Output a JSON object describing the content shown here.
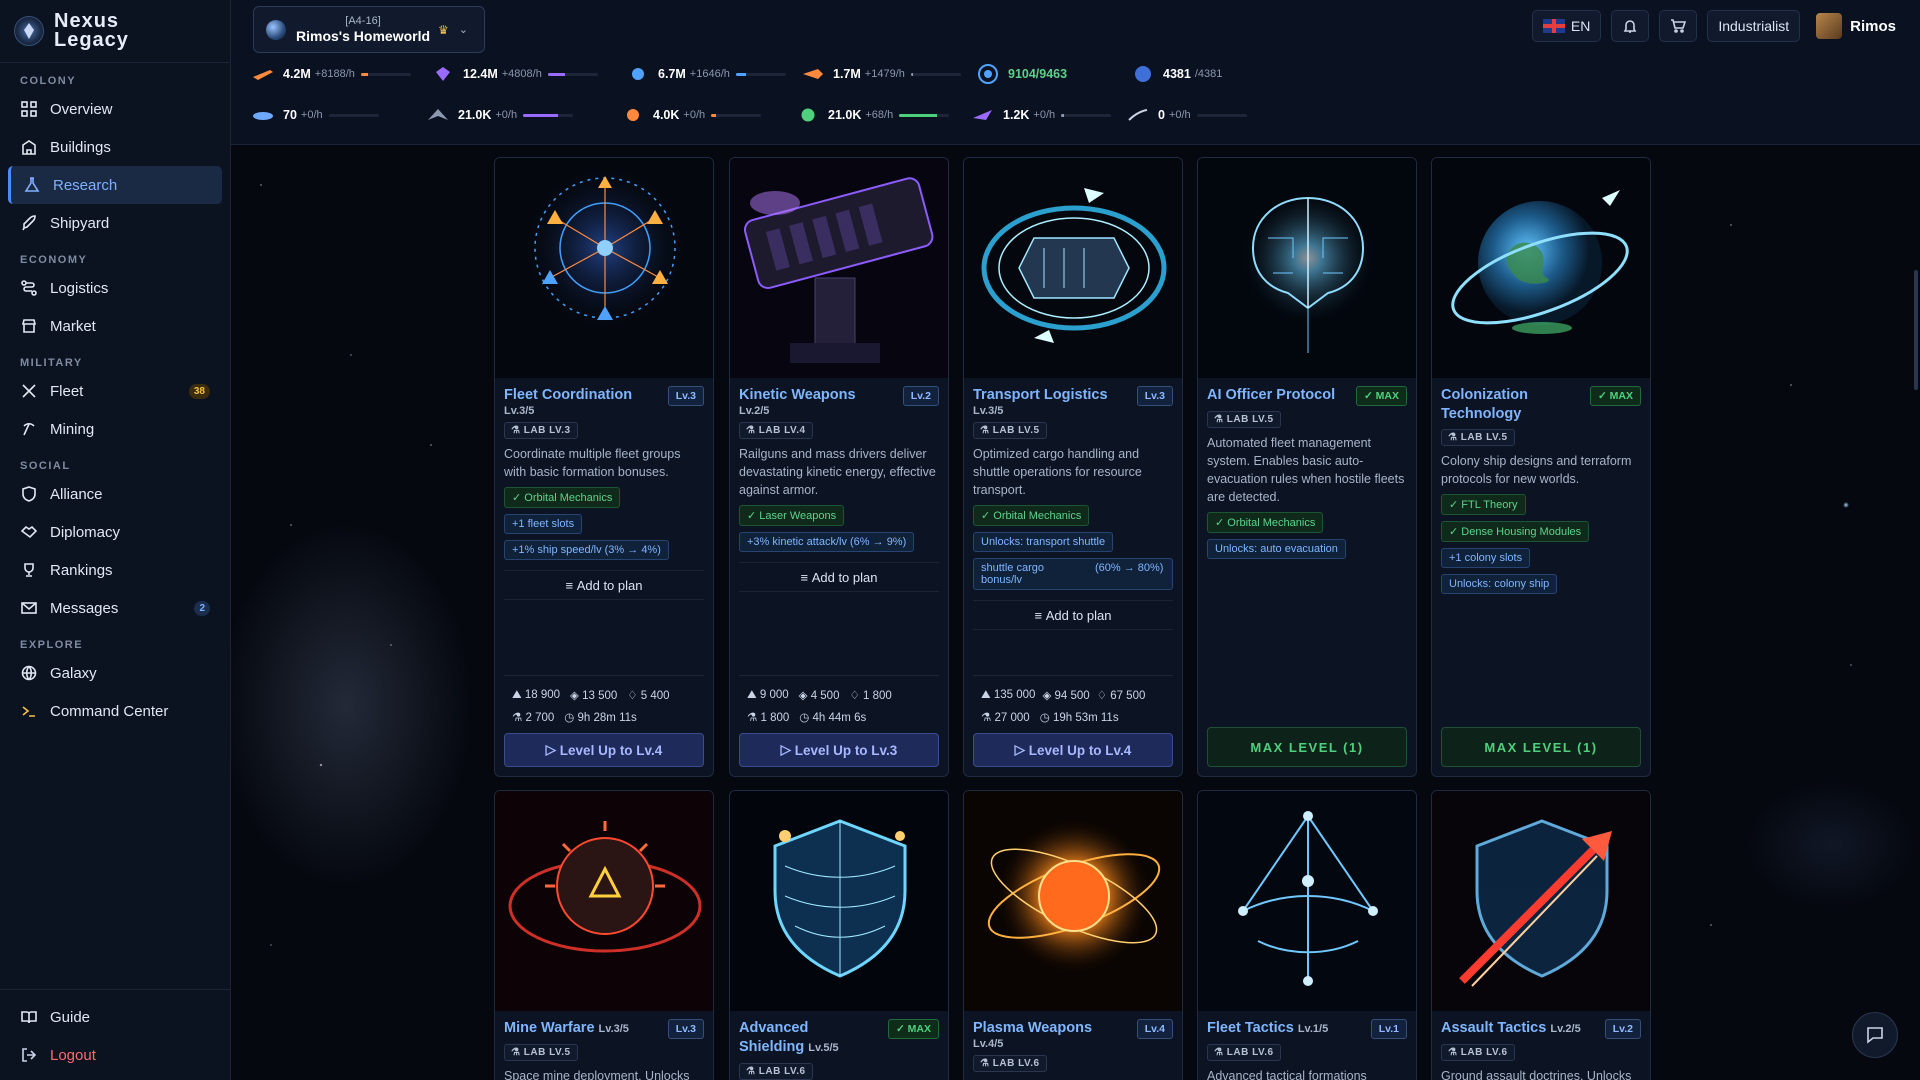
{
  "app": {
    "title_line1": "Nexus",
    "title_line2": "Legacy"
  },
  "nav": {
    "sections": {
      "colony": "COLONY",
      "economy": "ECONOMY",
      "military": "MILITARY",
      "social": "SOCIAL",
      "explore": "EXPLORE"
    },
    "overview": "Overview",
    "buildings": "Buildings",
    "research": "Research",
    "shipyard": "Shipyard",
    "logistics": "Logistics",
    "market": "Market",
    "fleet": "Fleet",
    "fleet_badge": "38",
    "mining": "Mining",
    "alliance": "Alliance",
    "diplomacy": "Diplomacy",
    "rankings": "Rankings",
    "messages": "Messages",
    "messages_badge": "2",
    "galaxy": "Galaxy",
    "command_center": "Command Center",
    "guide": "Guide",
    "logout": "Logout",
    "active": "research"
  },
  "header": {
    "planet_coords": "[A4-16]",
    "planet_name": "Rimos's Homeworld",
    "lang": "EN",
    "title_badge": "Industrialist",
    "user_name": "Rimos"
  },
  "resources": {
    "row1": [
      {
        "value": "4.2M",
        "rate": "+8188/h",
        "fill": 0.15,
        "color": "#ff8a3d",
        "icon": "ore-ship-icon"
      },
      {
        "value": "12.4M",
        "rate": "+4808/h",
        "fill": 0.35,
        "color": "#9b6bff",
        "icon": "crystal-icon"
      },
      {
        "value": "6.7M",
        "rate": "+1646/h",
        "fill": 0.2,
        "color": "#4fa3ff",
        "icon": "energy-orb-icon"
      },
      {
        "value": "1.7M",
        "rate": "+1479/h",
        "fill": 0.05,
        "color": "#8b98ae",
        "icon": "fuel-ship-icon"
      }
    ],
    "capacity": [
      {
        "value": "9104/9463",
        "icon": "population-icon",
        "color": "#5fd08a"
      },
      {
        "value": "4381",
        "max": "/4381",
        "icon": "storage-icon",
        "color": "#ffffff"
      }
    ],
    "row2": [
      {
        "value": "70",
        "rate": "+0/h",
        "fill": 0.0,
        "color": "#8b98ae",
        "icon": "drone-icon"
      },
      {
        "value": "21.0K",
        "rate": "+0/h",
        "fill": 0.7,
        "color": "#9b6bff",
        "icon": "fighter-icon"
      },
      {
        "value": "4.0K",
        "rate": "+0/h",
        "fill": 0.1,
        "color": "#ff8a3d",
        "icon": "sun-icon"
      },
      {
        "value": "21.0K",
        "rate": "+68/h",
        "fill": 0.75,
        "color": "#4fd07c",
        "icon": "globe-icon"
      },
      {
        "value": "1.2K",
        "rate": "+0/h",
        "fill": 0.05,
        "color": "#8b98ae",
        "icon": "cruiser-icon"
      },
      {
        "value": "0",
        "rate": "+0/h",
        "fill": 0.0,
        "color": "#8b98ae",
        "icon": "comet-icon"
      }
    ]
  },
  "cards": [
    {
      "title": "Fleet Coordination",
      "level_progress": "Lv.3/5",
      "level_tag": "Lv.3",
      "lab": "LAB LV.3",
      "desc": "Coordinate multiple fleet groups with basic formation bonuses.",
      "prereqs": [
        "Orbital Mechanics"
      ],
      "effects": [
        "+1 fleet slots",
        "+1% ship speed/lv (3% → 4%)"
      ],
      "add_plan": "Add to plan",
      "cost1": [
        "18 900",
        "13 500",
        "5 400"
      ],
      "cost2": [
        "2 700",
        "9h 28m 11s"
      ],
      "action": "Level Up to Lv.4",
      "art": "fleet"
    },
    {
      "title": "Kinetic Weapons",
      "level_progress": "Lv.2/5",
      "level_tag": "Lv.2",
      "lab": "LAB LV.4",
      "desc": "Railguns and mass drivers deliver devastating kinetic energy, effective against armor.",
      "prereqs": [
        "Laser Weapons"
      ],
      "effects": [
        "+3% kinetic attack/lv (6% → 9%)"
      ],
      "add_plan": "Add to plan",
      "cost1": [
        "9 000",
        "4 500",
        "1 800"
      ],
      "cost2": [
        "1 800",
        "4h 44m 6s"
      ],
      "action": "Level Up to Lv.3",
      "art": "kinetic"
    },
    {
      "title": "Transport Logistics",
      "level_progress": "Lv.3/5",
      "level_tag": "Lv.3",
      "lab": "LAB LV.5",
      "desc": "Optimized cargo handling and shuttle operations for resource transport.",
      "prereqs": [
        "Orbital Mechanics"
      ],
      "effects": [
        "Unlocks: transport shuttle"
      ],
      "effect_box": {
        "label": "shuttle cargo bonus/lv",
        "value": "(60% → 80%)"
      },
      "add_plan": "Add to plan",
      "cost1": [
        "135 000",
        "94 500",
        "67 500"
      ],
      "cost2": [
        "27 000",
        "19h 53m 11s"
      ],
      "action": "Level Up to Lv.4",
      "art": "transport"
    },
    {
      "title": "AI Officer Protocol",
      "level_tag": "MAX",
      "lab": "LAB LV.5",
      "desc": "Automated fleet management system. Enables basic auto-evacuation rules when hostile fleets are detected.",
      "prereqs": [
        "Orbital Mechanics"
      ],
      "effects": [
        "Unlocks: auto evacuation"
      ],
      "action": "MAX LEVEL (1)",
      "art": "ai"
    },
    {
      "title_line1": "Colonization",
      "title_line2": "Technology",
      "level_tag": "MAX",
      "lab": "LAB LV.5",
      "desc": "Colony ship designs and terraform protocols for new worlds.",
      "prereqs": [
        "FTL Theory",
        "Dense Housing Modules"
      ],
      "effects": [
        "+1 colony slots",
        "Unlocks: colony ship"
      ],
      "action": "MAX LEVEL (1)",
      "art": "colony"
    }
  ],
  "cards2": [
    {
      "title": "Mine Warfare",
      "level_progress": "Lv.3/5",
      "level_tag": "Lv.3",
      "lab": "LAB LV.5",
      "desc": "Space mine deployment. Unlocks",
      "art": "mine"
    },
    {
      "title_line1": "Advanced",
      "title_line2": "Shielding",
      "level_progress": "Lv.5/5",
      "level_tag": "MAX",
      "lab": "LAB LV.6",
      "art": "shield"
    },
    {
      "title": "Plasma Weapons",
      "level_progress": "Lv.4/5",
      "level_tag": "Lv.4",
      "lab": "LAB LV.6",
      "art": "plasma"
    },
    {
      "title": "Fleet Tactics",
      "level_progress": "Lv.1/5",
      "level_tag": "Lv.1",
      "lab": "LAB LV.6",
      "desc": "Advanced tactical formations",
      "art": "tactics"
    },
    {
      "title": "Assault Tactics",
      "level_progress": "Lv.2/5",
      "level_tag": "Lv.2",
      "lab": "LAB LV.6",
      "desc": "Ground assault doctrines. Unlocks",
      "art": "assault"
    }
  ]
}
